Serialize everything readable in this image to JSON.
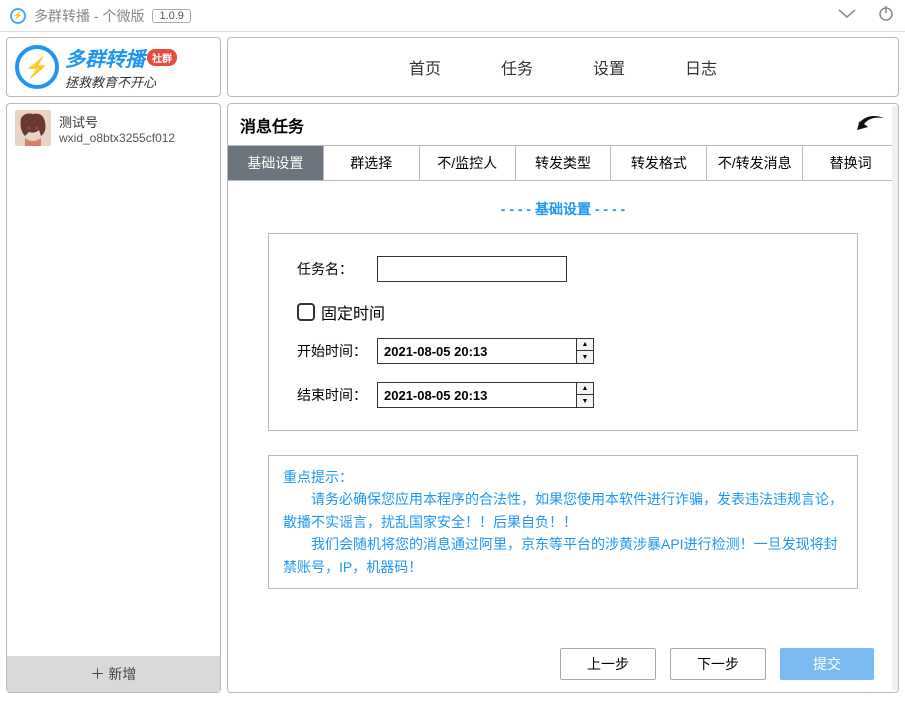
{
  "titlebar": {
    "title": "多群转播 - 个微版",
    "version": "1.0.9"
  },
  "brand": {
    "name": "多群转播",
    "badge": "社群",
    "slogan": "拯救教育不开心"
  },
  "account": {
    "name": "测试号",
    "wxid": "wxid_o8btx3255cf012"
  },
  "sidebar": {
    "add": "＋ 新增"
  },
  "nav": {
    "items": [
      "首页",
      "任务",
      "设置",
      "日志"
    ]
  },
  "content": {
    "title": "消息任务",
    "tabs": [
      "基础设置",
      "群选择",
      "不/监控人",
      "转发类型",
      "转发格式",
      "不/转发消息",
      "替换词"
    ],
    "section": "- - - - 基础设置 - - - -",
    "taskname_label": "任务名：",
    "taskname_value": "",
    "fixedtime_label": "固定时间",
    "start_label": "开始时间：",
    "start_value": "2021-08-05 20:13",
    "end_label": "结束时间：",
    "end_value": "2021-08-05 20:13",
    "notice_title": "重点提示：",
    "notice_body1": "　　请务必确保您应用本程序的合法性，如果您使用本软件进行诈骗，发表违法违规言论，散播不实谣言，扰乱国家安全！！后果自负！！",
    "notice_body2": "　　我们会随机将您的消息通过阿里，京东等平台的涉黄涉暴API进行检测！一旦发现将封禁账号，IP，机器码！",
    "btn_prev": "上一步",
    "btn_next": "下一步",
    "btn_submit": "提交"
  }
}
